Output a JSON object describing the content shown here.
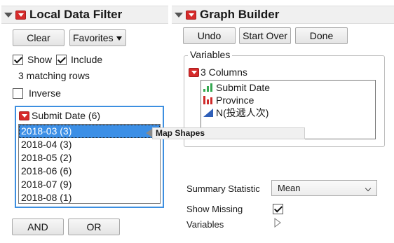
{
  "local_data_filter": {
    "title": "Local Data Filter",
    "clear_label": "Clear",
    "favorites_label": "Favorites",
    "show_label": "Show",
    "show_checked": true,
    "include_label": "Include",
    "include_checked": true,
    "matching_rows": "3 matching rows",
    "inverse_label": "Inverse",
    "inverse_checked": false,
    "filter": {
      "title": "Submit Date (6)",
      "items": [
        {
          "label": "2018-03 (3)",
          "selected": true
        },
        {
          "label": "2018-04 (3)",
          "selected": false
        },
        {
          "label": "2018-05 (2)",
          "selected": false
        },
        {
          "label": "2018-06 (6)",
          "selected": false
        },
        {
          "label": "2018-07 (9)",
          "selected": false
        },
        {
          "label": "2018-08 (1)",
          "selected": false
        }
      ]
    },
    "and_label": "AND",
    "or_label": "OR"
  },
  "tooltip": {
    "text": "Map Shapes"
  },
  "graph_builder": {
    "title": "Graph Builder",
    "undo_label": "Undo",
    "start_over_label": "Start Over",
    "done_label": "Done",
    "variables_group": "Variables",
    "columns_header": "3 Columns",
    "columns": [
      {
        "name": "Submit Date",
        "icon": "continuous-icon"
      },
      {
        "name": "Province",
        "icon": "nominal-icon"
      },
      {
        "name": "N(投遞人次)",
        "icon": "ordinal-icon"
      }
    ],
    "summary_statistic_label": "Summary Statistic",
    "summary_statistic_value": "Mean",
    "show_missing_label": "Show Missing",
    "show_missing_checked": true,
    "variables_label": "Variables"
  },
  "colors": {
    "accent": "#3c8fe6",
    "red_button": "#d62b2b",
    "continuous": "#36a852",
    "nominal": "#cf2a2a",
    "ordinal": "#2f5fb8"
  }
}
